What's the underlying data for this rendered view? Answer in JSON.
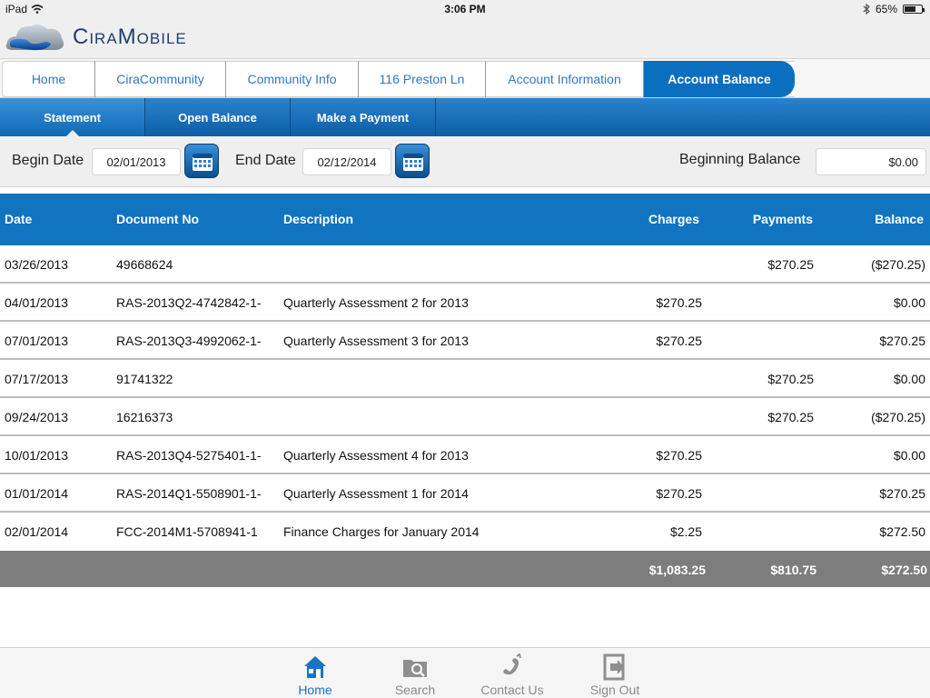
{
  "status_bar": {
    "device": "iPad",
    "time": "3:06 PM",
    "battery": "65%",
    "battery_level": 0.65
  },
  "header": {
    "logo_text": "CiraMobile"
  },
  "nav": {
    "items": [
      {
        "label": "Home"
      },
      {
        "label": "CiraCommunity"
      },
      {
        "label": "Community Info"
      },
      {
        "label": "116 Preston Ln"
      },
      {
        "label": "Account Information"
      },
      {
        "label": "Account Balance",
        "active": true
      }
    ]
  },
  "subtabs": {
    "items": [
      {
        "label": "Statement",
        "active": true
      },
      {
        "label": "Open Balance"
      },
      {
        "label": "Make a Payment"
      }
    ]
  },
  "filter": {
    "begin_label": "Begin Date",
    "begin_value": "02/01/2013",
    "end_label": "End Date",
    "end_value": "02/12/2014",
    "beginning_balance_label": "Beginning Balance",
    "beginning_balance_value": "$0.00"
  },
  "table": {
    "headers": {
      "date": "Date",
      "document": "Document No",
      "description": "Description",
      "charges": "Charges",
      "payments": "Payments",
      "balance": "Balance"
    },
    "rows": [
      {
        "date": "03/26/2013",
        "document": "49668624",
        "description": "",
        "charges": "",
        "payments": "$270.25",
        "balance": "($270.25)"
      },
      {
        "date": "04/01/2013",
        "document": "RAS-2013Q2-4742842-1-",
        "description": "Quarterly Assessment 2 for 2013",
        "charges": "$270.25",
        "payments": "",
        "balance": "$0.00"
      },
      {
        "date": "07/01/2013",
        "document": "RAS-2013Q3-4992062-1-",
        "description": "Quarterly Assessment 3 for 2013",
        "charges": "$270.25",
        "payments": "",
        "balance": "$270.25"
      },
      {
        "date": "07/17/2013",
        "document": "91741322",
        "description": "",
        "charges": "",
        "payments": "$270.25",
        "balance": "$0.00"
      },
      {
        "date": "09/24/2013",
        "document": "16216373",
        "description": "",
        "charges": "",
        "payments": "$270.25",
        "balance": "($270.25)"
      },
      {
        "date": "10/01/2013",
        "document": "RAS-2013Q4-5275401-1-",
        "description": "Quarterly Assessment 4 for 2013",
        "charges": "$270.25",
        "payments": "",
        "balance": "$0.00"
      },
      {
        "date": "01/01/2014",
        "document": "RAS-2014Q1-5508901-1-",
        "description": "Quarterly Assessment 1 for 2014",
        "charges": "$270.25",
        "payments": "",
        "balance": "$270.25"
      },
      {
        "date": "02/01/2014",
        "document": "FCC-2014M1-5708941-1",
        "description": "Finance Charges for January 2014",
        "charges": "$2.25",
        "payments": "",
        "balance": "$272.50"
      }
    ],
    "totals": {
      "charges": "$1,083.25",
      "payments": "$810.75",
      "balance": "$272.50"
    }
  },
  "tabbar": {
    "items": [
      {
        "label": "Home",
        "icon": "home-icon",
        "active": true
      },
      {
        "label": "Search",
        "icon": "search-folder-icon"
      },
      {
        "label": "Contact Us",
        "icon": "phone-icon"
      },
      {
        "label": "Sign Out",
        "icon": "sign-out-icon"
      }
    ]
  },
  "colors": {
    "accent": "#1074c0",
    "totals_bg": "#7d7d7d",
    "link": "#2f78c4"
  }
}
